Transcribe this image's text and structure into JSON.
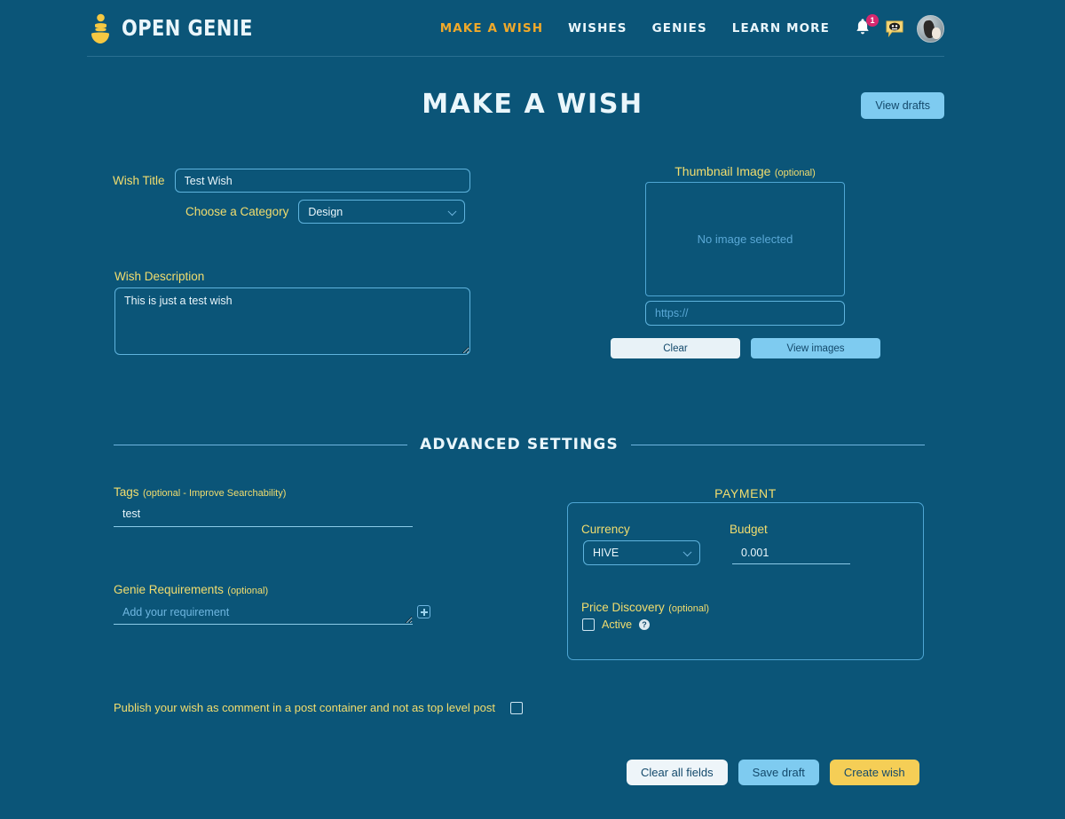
{
  "brand": {
    "name": "OPEN GENIE",
    "logo_icon": "genie-lamp-icon"
  },
  "nav": {
    "items": [
      {
        "label": "MAKE A WISH",
        "active": true
      },
      {
        "label": "WISHES",
        "active": false
      },
      {
        "label": "GENIES",
        "active": false
      },
      {
        "label": "LEARN MORE",
        "active": false
      }
    ],
    "notification_icon": "bell-icon",
    "notification_count": "1",
    "messages_icon": "chat-bubble-icon",
    "avatar_icon": "user-avatar"
  },
  "page": {
    "title": "MAKE A WISH",
    "view_drafts_label": "View drafts"
  },
  "form": {
    "wish_title_label": "Wish Title",
    "wish_title_value": "Test Wish",
    "wish_title_placeholder": "",
    "category_label": "Choose a Category",
    "category_value": "Design",
    "category_options": [
      "Design"
    ],
    "description_label": "Wish Description",
    "description_value": "This is just a test wish",
    "description_placeholder": ""
  },
  "thumbnail": {
    "label": "Thumbnail Image",
    "optional": "(optional)",
    "empty_text": "No image selected",
    "url_placeholder": "https://",
    "url_value": "",
    "clear_label": "Clear",
    "view_images_label": "View images"
  },
  "advanced": {
    "divider_title": "ADVANCED SETTINGS",
    "tags_label": "Tags",
    "tags_optional": "(optional - Improve Searchability)",
    "tags_value": "test",
    "tags_placeholder": "",
    "requirements_label": "Genie Requirements",
    "requirements_optional": "(optional)",
    "requirements_placeholder": "Add your requirement",
    "requirements_value": "",
    "add_requirement_icon": "plus-icon"
  },
  "payment": {
    "title": "PAYMENT",
    "currency_label": "Currency",
    "currency_value": "HIVE",
    "currency_options": [
      "HIVE"
    ],
    "budget_label": "Budget",
    "budget_value": "0.001",
    "budget_placeholder": "",
    "price_discovery_label": "Price Discovery",
    "price_discovery_optional": "(optional)",
    "active_label": "Active",
    "active_checked": false,
    "help_icon": "question-mark-icon"
  },
  "publish": {
    "label": "Publish your wish as comment in a post container and not as top level post",
    "checked": false
  },
  "footer": {
    "clear_all_label": "Clear all fields",
    "save_draft_label": "Save draft",
    "create_wish_label": "Create wish"
  },
  "colors": {
    "background": "#0b5578",
    "accent_yellow": "#f0a92a",
    "label_yellow": "#f2dd6e",
    "light_blue": "#7ecbf0",
    "create_wish": "#f5ce56",
    "badge_pink": "#d6286e"
  }
}
